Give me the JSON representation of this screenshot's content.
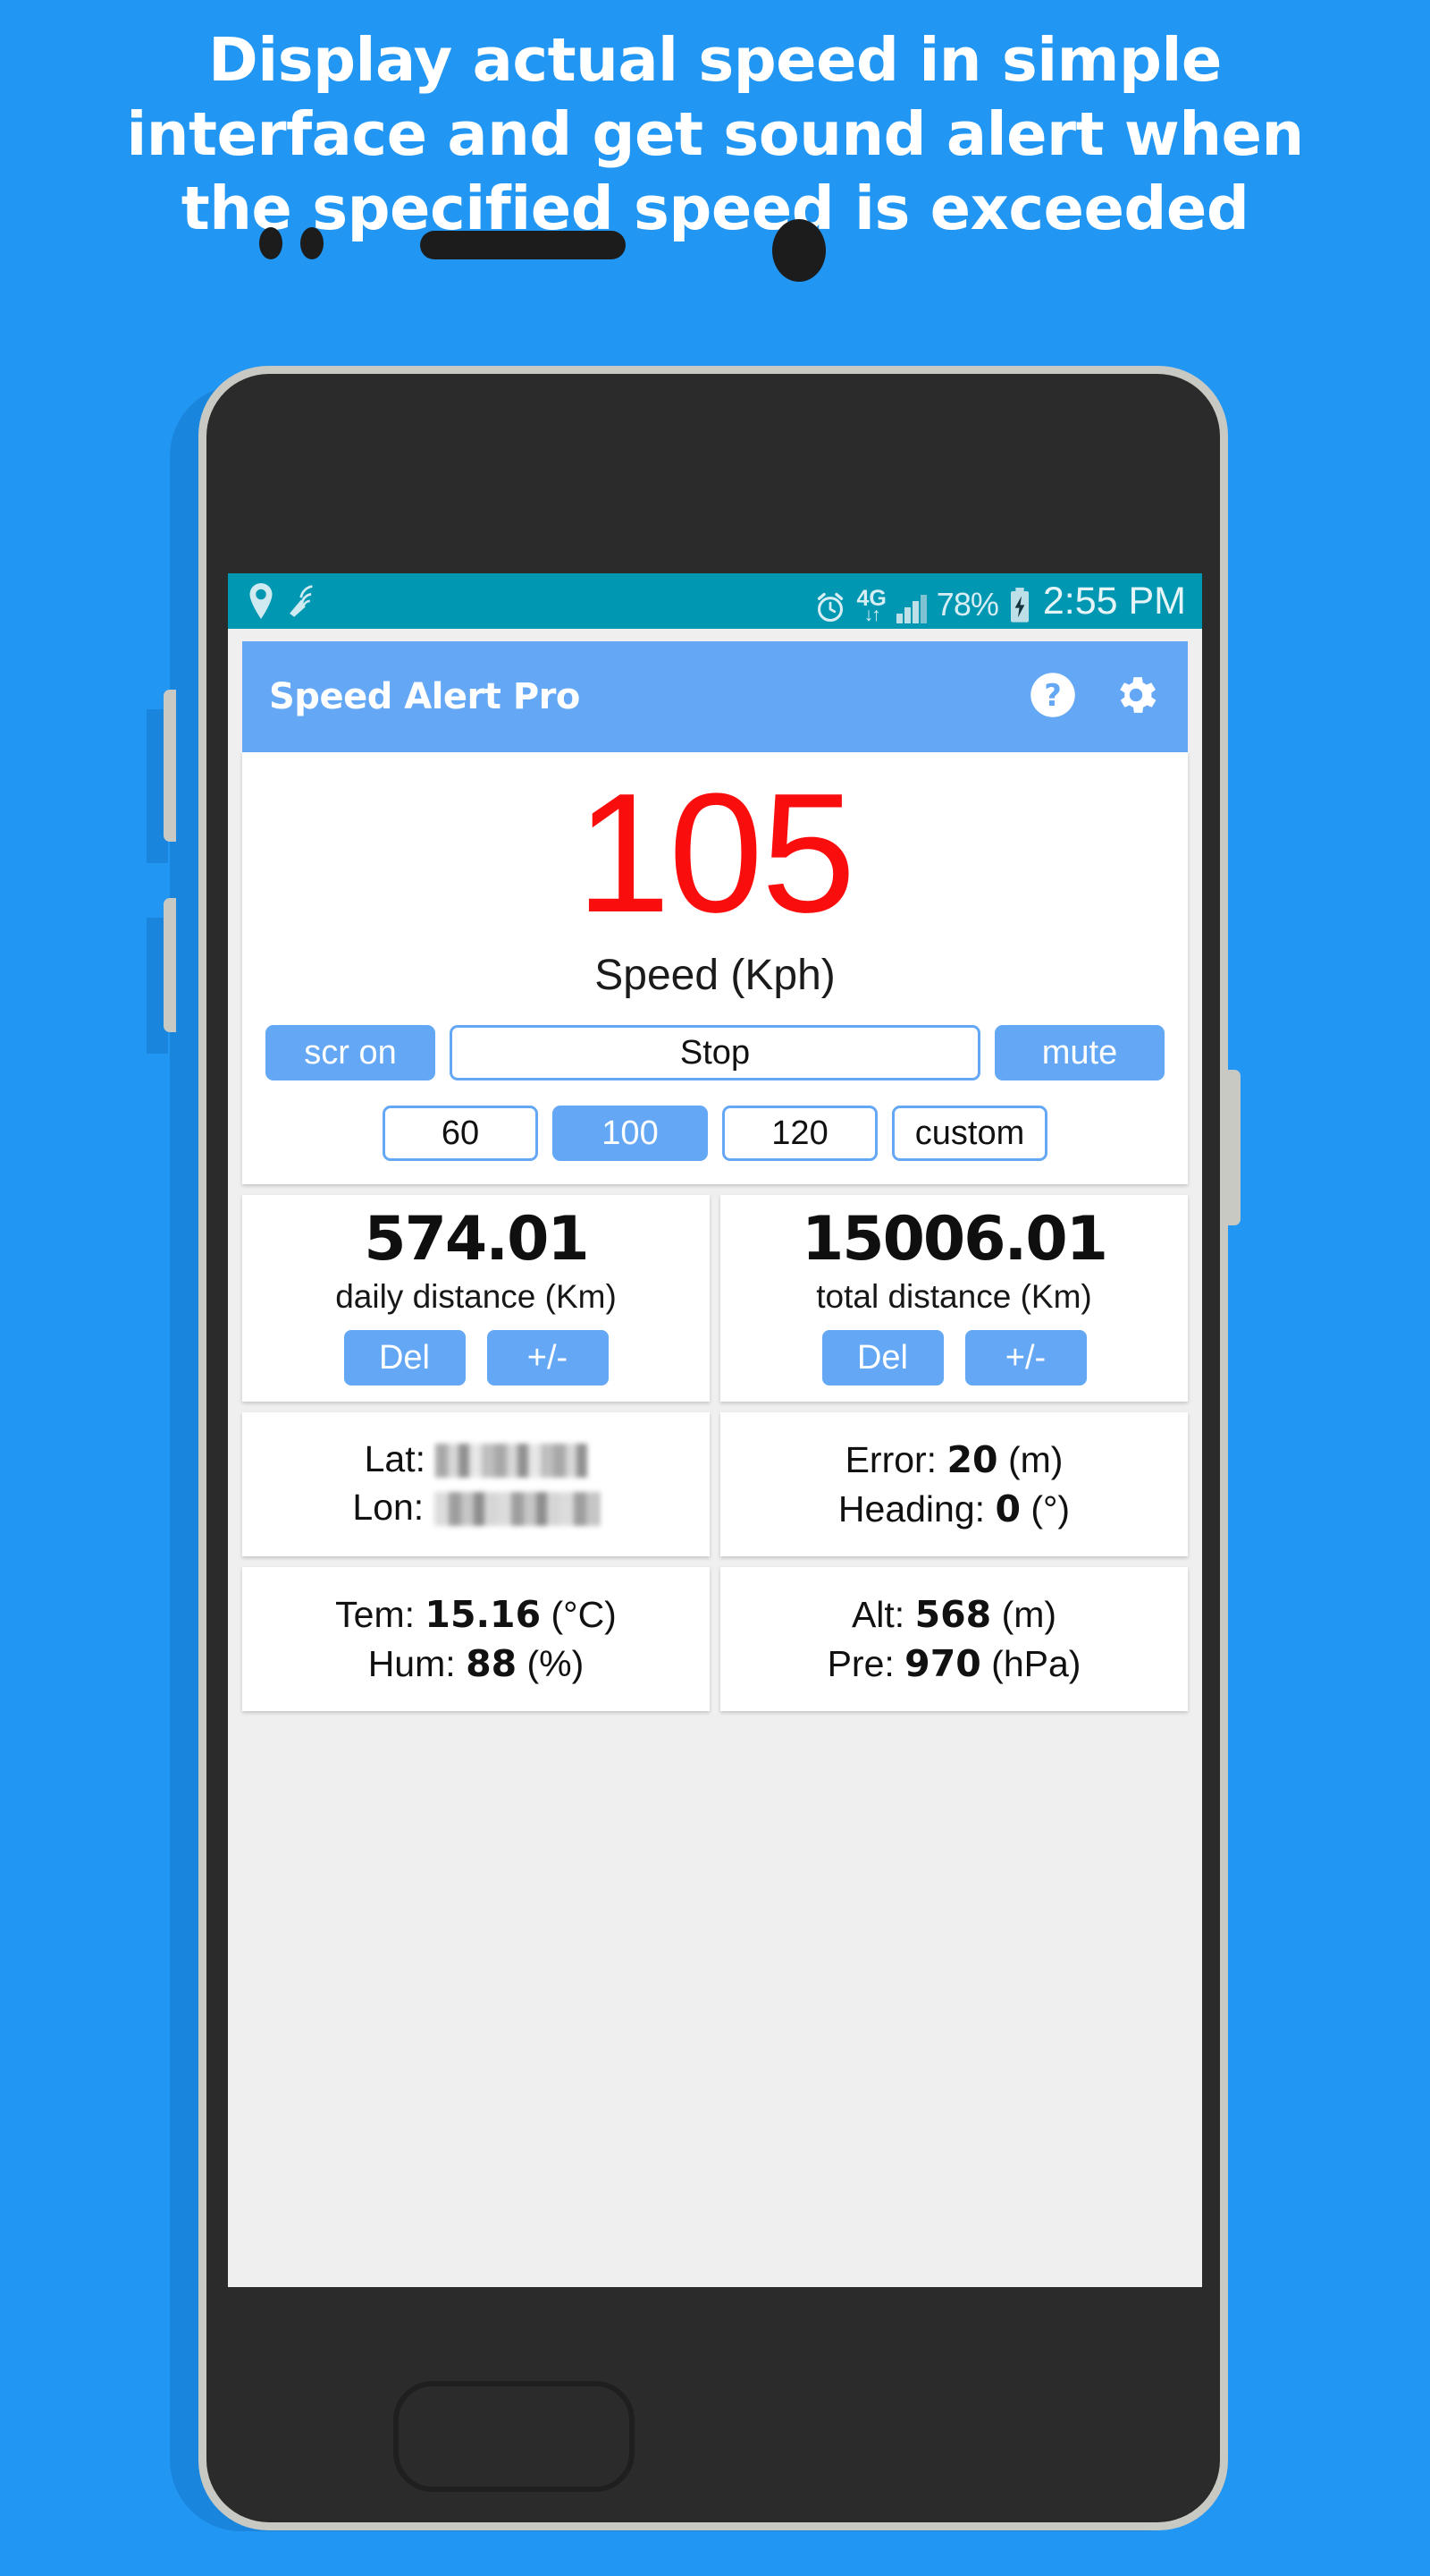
{
  "promo": {
    "line1": "Display actual speed in simple",
    "line2": "interface and get sound alert when",
    "line3": "the specified speed is exceeded"
  },
  "colors": {
    "background": "#2196f3",
    "status_bar": "#0097b2",
    "app_bar": "#64a8f5",
    "accent": "#64a8f5",
    "speed_value": "#fa0d0d",
    "screen_bg": "#efefef"
  },
  "status_bar": {
    "icons_left": [
      "location-icon",
      "gps-satellite-icon"
    ],
    "alarm_icon": "alarm-icon",
    "network": "4G",
    "data_arrows": "↓↑",
    "signal_icon": "signal-bars-icon",
    "battery_percent": "78%",
    "battery_icon": "battery-charging-icon",
    "clock": "2:55 PM"
  },
  "app_bar": {
    "title": "Speed Alert Pro",
    "help_icon": "help-circle-icon",
    "settings_icon": "gear-icon"
  },
  "speed": {
    "value": "105",
    "label": "Speed (Kph)"
  },
  "controls": {
    "row1": [
      {
        "label": "scr on",
        "style": "filled"
      },
      {
        "label": "Stop",
        "style": "outline"
      },
      {
        "label": "mute",
        "style": "filled"
      }
    ],
    "row2": [
      {
        "label": "60",
        "style": "outline"
      },
      {
        "label": "100",
        "style": "filled"
      },
      {
        "label": "120",
        "style": "outline"
      },
      {
        "label": "custom",
        "style": "outline"
      }
    ]
  },
  "distance": {
    "daily": {
      "value": "574.01",
      "label": "daily distance (Km)",
      "delete_label": "Del",
      "plusminus_label": "+/-"
    },
    "total": {
      "value": "15006.01",
      "label": "total distance (Km)",
      "delete_label": "Del",
      "plusminus_label": "+/-"
    }
  },
  "location": {
    "lat_label": "Lat:",
    "lat_value": "",
    "lon_label": "Lon:",
    "lon_value": "",
    "error_label": "Error:",
    "error_value": "20",
    "error_unit": "(m)",
    "heading_label": "Heading:",
    "heading_value": "0",
    "heading_unit": "(°)"
  },
  "environment": {
    "temp_label": "Tem:",
    "temp_value": "15.16",
    "temp_unit": "(°C)",
    "hum_label": "Hum:",
    "hum_value": "88",
    "hum_unit": "(%)",
    "alt_label": "Alt:",
    "alt_value": "568",
    "alt_unit": "(m)",
    "pre_label": "Pre:",
    "pre_value": "970",
    "pre_unit": "(hPa)"
  }
}
